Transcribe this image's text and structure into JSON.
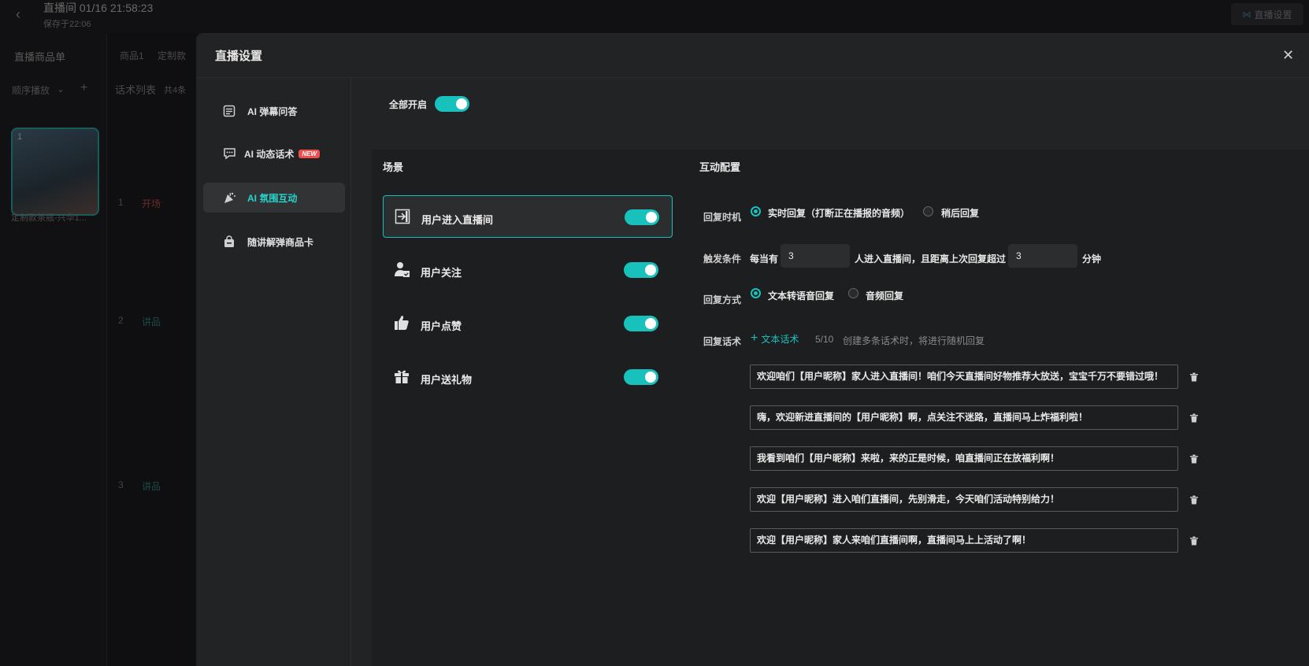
{
  "app": {
    "title": "直播间 01/16 21:58:23",
    "saved_at": "保存于22:06",
    "top_button": "直播设置",
    "back_icon": "chevron-left-icon"
  },
  "background": {
    "product_list_title": "直播商品单",
    "tab1": "商品1",
    "tab2": "定制款",
    "order_mode": "顺序播放",
    "script_list": "话术列表",
    "script_count": "共4条",
    "thumb_index": "1",
    "thumb_caption": "定制款茶瓶-兴华1...",
    "rows": [
      {
        "num": "1",
        "tag": "开场",
        "color": "#6b2a2a"
      },
      {
        "num": "2",
        "tag": "讲品",
        "color": "#1d4a48"
      },
      {
        "num": "3",
        "tag": "讲品",
        "color": "#1d4a48"
      }
    ]
  },
  "modal": {
    "title": "直播设置",
    "close_icon": "close-icon",
    "nav": [
      {
        "label": "AI 弹幕问答",
        "icon": "chat-list-icon",
        "active": false
      },
      {
        "label": "AI 动态话术",
        "icon": "speech-bubble-icon",
        "badge": "NEW",
        "active": false
      },
      {
        "label": "AI 氛围互动",
        "icon": "party-popper-icon",
        "active": true
      },
      {
        "label": "随讲解弹商品卡",
        "icon": "shopping-bag-icon",
        "active": false
      }
    ],
    "all_on_label": "全部开启",
    "scene_title": "场景",
    "config_title": "互动配置",
    "scenes": [
      {
        "label": "用户进入直播间",
        "icon": "enter-room-icon",
        "enabled": true,
        "active": true
      },
      {
        "label": "用户关注",
        "icon": "user-follow-icon",
        "enabled": true,
        "active": false
      },
      {
        "label": "用户点赞",
        "icon": "thumbs-up-icon",
        "enabled": true,
        "active": false
      },
      {
        "label": "用户送礼物",
        "icon": "gift-icon",
        "enabled": true,
        "active": false
      }
    ],
    "config": {
      "reply_timing_label": "回复时机",
      "reply_timing_options": [
        "实时回复（打断正在播报的音频）",
        "稍后回复"
      ],
      "reply_timing_selected": 0,
      "trigger_label": "触发条件",
      "trigger_prefix": "每当有",
      "trigger_count": "3",
      "trigger_mid": "人进入直播间，且距离上次回复超过",
      "trigger_minutes": "3",
      "trigger_suffix": "分钟",
      "reply_mode_label": "回复方式",
      "reply_mode_options": [
        "文本转语音回复",
        "音频回复"
      ],
      "reply_mode_selected": 0,
      "reply_script_label": "回复话术",
      "add_text_script": "文本话术",
      "script_count": "5/10",
      "script_hint": "创建多条话术时，将进行随机回复",
      "scripts": [
        "欢迎咱们【用户昵称】家人进入直播间！咱们今天直播间好物推荐大放送，宝宝千万不要错过哦！",
        "嗨，欢迎新进直播间的【用户昵称】啊，点关注不迷路，直播间马上炸福利啦！",
        "我看到咱们【用户昵称】来啦，来的正是时候，咱直播间正在放福利啊！",
        "欢迎【用户昵称】进入咱们直播间，先别滑走，今天咱们活动特别给力！",
        "欢迎【用户昵称】家人来咱们直播间啊，直播间马上上活动了啊！"
      ]
    }
  },
  "colors": {
    "accent": "#19c1bd",
    "badge": "#f14d4d",
    "modal_bg": "#222324"
  }
}
